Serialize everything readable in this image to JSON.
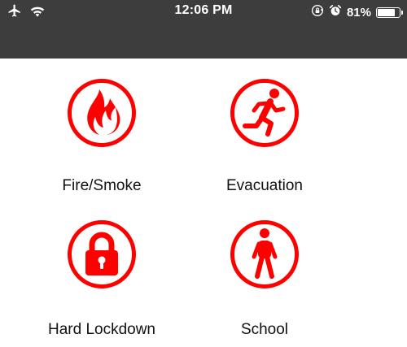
{
  "status_bar": {
    "time": "12:06 PM",
    "battery_percent": "81%",
    "battery_level": 0.81,
    "background_color": "#3d3d3d",
    "left_icons": [
      "airplane-mode-icon",
      "wifi-icon"
    ],
    "right_icons": [
      "orientation-lock-icon",
      "alarm-icon",
      "battery-icon"
    ]
  },
  "accent_color": "#ff0000",
  "alerts": [
    {
      "label": "Fire/Smoke",
      "icon": "fire-icon"
    },
    {
      "label": "Evacuation",
      "icon": "running-person-icon"
    },
    {
      "label": "Hard Lockdown",
      "icon": "padlock-icon"
    },
    {
      "label": "School",
      "icon": "walking-person-icon"
    }
  ]
}
